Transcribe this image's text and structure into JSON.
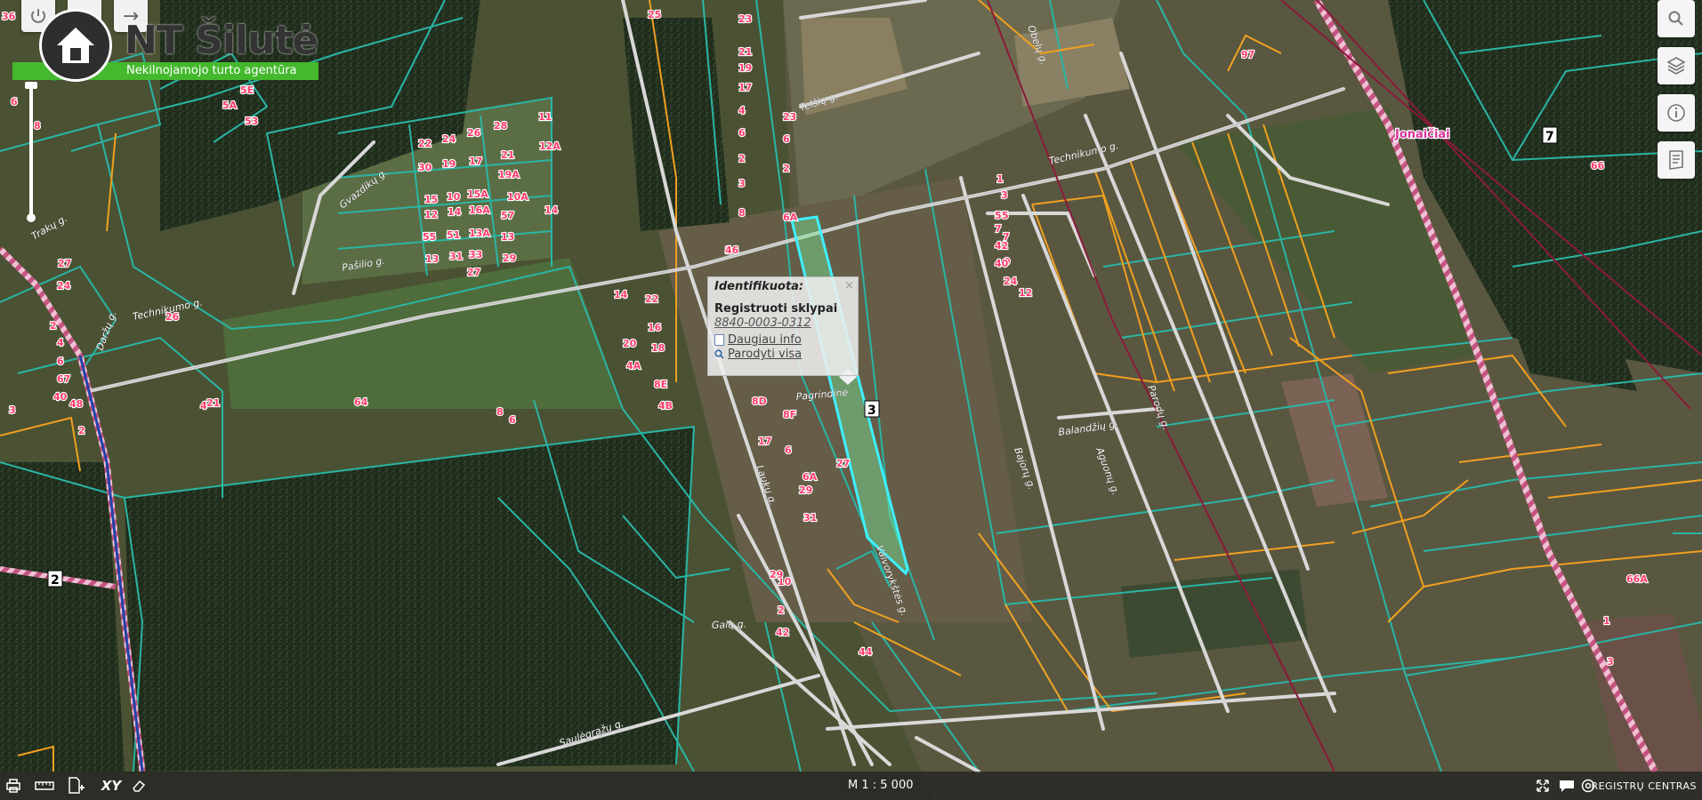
{
  "brand": {
    "name": "NT Šilutė",
    "tagline": "Nekilnojamojo turto agentūra"
  },
  "popup": {
    "title": "Identifikuota:",
    "close": "×",
    "layer": "Registruoti sklypai",
    "parcel_id": "8840-0003-0312",
    "more_info": "Daugiau info",
    "show_all": "Parodyti visa"
  },
  "streets": {
    "technikumo_1": "Technikumo g.",
    "technikumo_2": "Technikumo g.",
    "technikumo_3": "Technikumo g.",
    "telsiu": "Telšių g.",
    "gvazdiku": "Gvazdikų g.",
    "pasilio": "Pašilio g.",
    "darzeliu": "Daržų g.",
    "pagrindine": "Pagrindinė",
    "bajoru": "Bajorų g.",
    "balandziu": "Balandžių g.",
    "ayuoku": "Aguonų g.",
    "parodziu": "Parodų g.",
    "sauleg": "Saulėgrąžų g.",
    "vejo": "Vaivorykštės g.",
    "laiko": "Laukų g.",
    "gali": "Galų g.",
    "obelu": "Obelų g.",
    "trakai": "Trakų g."
  },
  "places": {
    "jonaiciai": "Jonaičiai"
  },
  "house_numbers": [
    "36",
    "6",
    "8",
    "5A",
    "5E",
    "53",
    "22",
    "24",
    "26",
    "28",
    "21",
    "30",
    "19",
    "17",
    "19A",
    "15",
    "10",
    "15A",
    "10A",
    "12",
    "14",
    "16A",
    "57",
    "55",
    "51",
    "13A",
    "13",
    "11",
    "12A",
    "14",
    "13",
    "31",
    "33",
    "29",
    "27",
    "25",
    "23",
    "21",
    "19",
    "17",
    "4",
    "6",
    "2",
    "3",
    "8",
    "2",
    "6",
    "6A",
    "2",
    "1",
    "3",
    "5",
    "7",
    "9",
    "24",
    "12",
    "14",
    "22",
    "16",
    "20",
    "18",
    "4A",
    "8E",
    "4B",
    "8D",
    "8F",
    "17",
    "6",
    "6A",
    "27",
    "29",
    "31",
    "10",
    "2",
    "42",
    "44",
    "46",
    "48",
    "40",
    "3",
    "2",
    "21",
    "4",
    "6",
    "8",
    "64",
    "23",
    "97",
    "66",
    "66A",
    "1",
    "3",
    "5",
    "7",
    "42",
    "40",
    "2",
    "4",
    "6",
    "67",
    "26",
    "24",
    "27",
    "29"
  ],
  "road_numbers": {
    "left": "2",
    "center": "3",
    "right": "7"
  },
  "scale": "M 1 : 5 000",
  "footer_brand": "REGISTRŲ CENTRAS",
  "icons": {
    "power": "power-icon",
    "back": "back-icon",
    "forward": "forward-icon",
    "search": "search-icon",
    "layers": "layers-icon",
    "info": "info-icon",
    "legend": "legend-icon",
    "print": "print-icon",
    "measure": "ruler-icon",
    "add": "add-document-icon",
    "coords": "xy-icon",
    "erase": "eraser-icon",
    "fullscreen": "fullscreen-icon",
    "chat": "chat-icon",
    "copyright": "copyright-icon"
  },
  "colors": {
    "parcel_outline": "#2ab5a5",
    "orange_outline": "#f0a020",
    "selected_parcel": "#3ef0ff",
    "road": "#d8d8d8",
    "railway": "#e0558c",
    "logo_green": "#45b92d"
  }
}
